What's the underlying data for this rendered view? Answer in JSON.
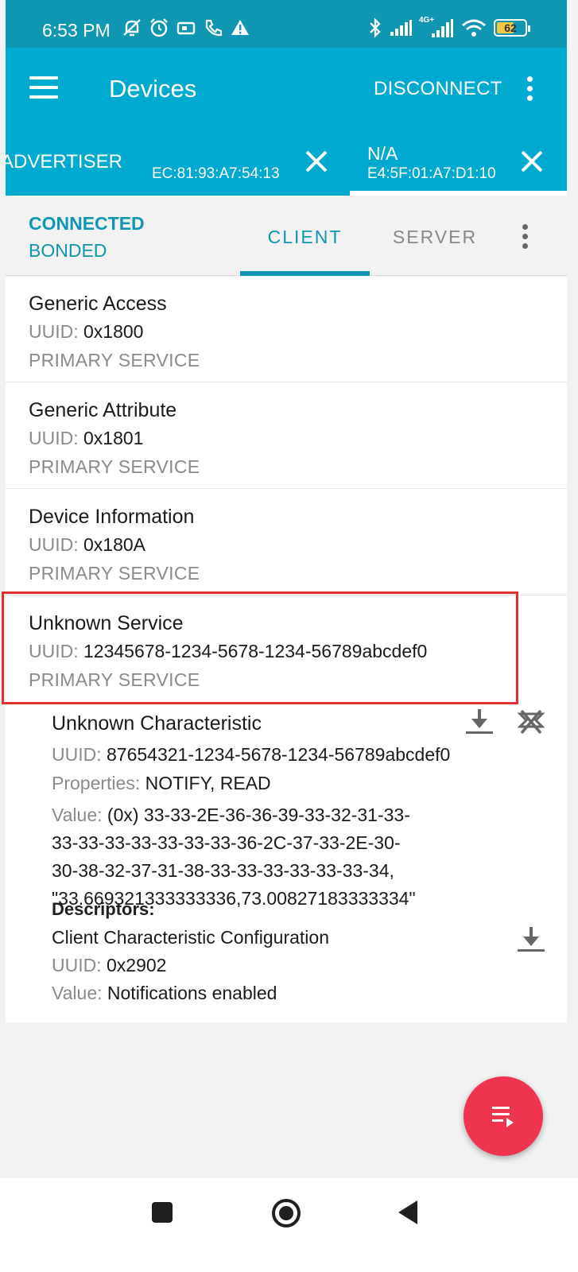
{
  "status_bar": {
    "time": "6:53 PM",
    "network": "4G+",
    "battery": "62",
    "battery_level": 0.62,
    "icons": [
      "mute-icon",
      "alarm-icon",
      "nfc-icon",
      "call-forward-icon",
      "warning-icon",
      "bluetooth-icon",
      "signal-icon",
      "signal-4g-icon",
      "wifi-icon",
      "battery-icon"
    ]
  },
  "appbar": {
    "title": "Devices",
    "disconnect_label": "DISCONNECT"
  },
  "device_tabs": [
    {
      "name": "ADVERTISER",
      "address": "EC:81:93:A7:54:13"
    },
    {
      "name": "N/A",
      "address": "E4:5F:01:A7:D1:10"
    }
  ],
  "connection": {
    "state": "CONNECTED",
    "bond": "BONDED"
  },
  "role_tabs": {
    "client": "CLIENT",
    "server": "SERVER"
  },
  "services": [
    {
      "name": "Generic Access",
      "uuid_label": "UUID:",
      "uuid": "0x1800",
      "type": "PRIMARY SERVICE"
    },
    {
      "name": "Generic Attribute",
      "uuid_label": "UUID:",
      "uuid": "0x1801",
      "type": "PRIMARY SERVICE"
    },
    {
      "name": "Device Information",
      "uuid_label": "UUID:",
      "uuid": "0x180A",
      "type": "PRIMARY SERVICE"
    },
    {
      "name": "Unknown Service",
      "uuid_label": "UUID:",
      "uuid": "12345678-1234-5678-1234-56789abcdef0",
      "type": "PRIMARY SERVICE"
    }
  ],
  "characteristic": {
    "name": "Unknown Characteristic",
    "uuid_label": "UUID:",
    "uuid": "87654321-1234-5678-1234-56789abcdef0",
    "properties_label": "Properties:",
    "properties": "NOTIFY, READ",
    "value_label": "Value:",
    "value_lines": [
      "(0x) 33-33-2E-36-36-39-33-32-31-33-",
      "33-33-33-33-33-33-33-36-2C-37-33-2E-30-",
      "30-38-32-37-31-38-33-33-33-33-33-33-34,",
      "\"33.669321333333336,73.00827183333334\""
    ],
    "descriptors_label": "Descriptors:",
    "descriptor": {
      "name": "Client Characteristic Configuration",
      "uuid_label": "UUID:",
      "uuid": "0x2902",
      "value_label": "Value:",
      "value": "Notifications enabled"
    }
  }
}
